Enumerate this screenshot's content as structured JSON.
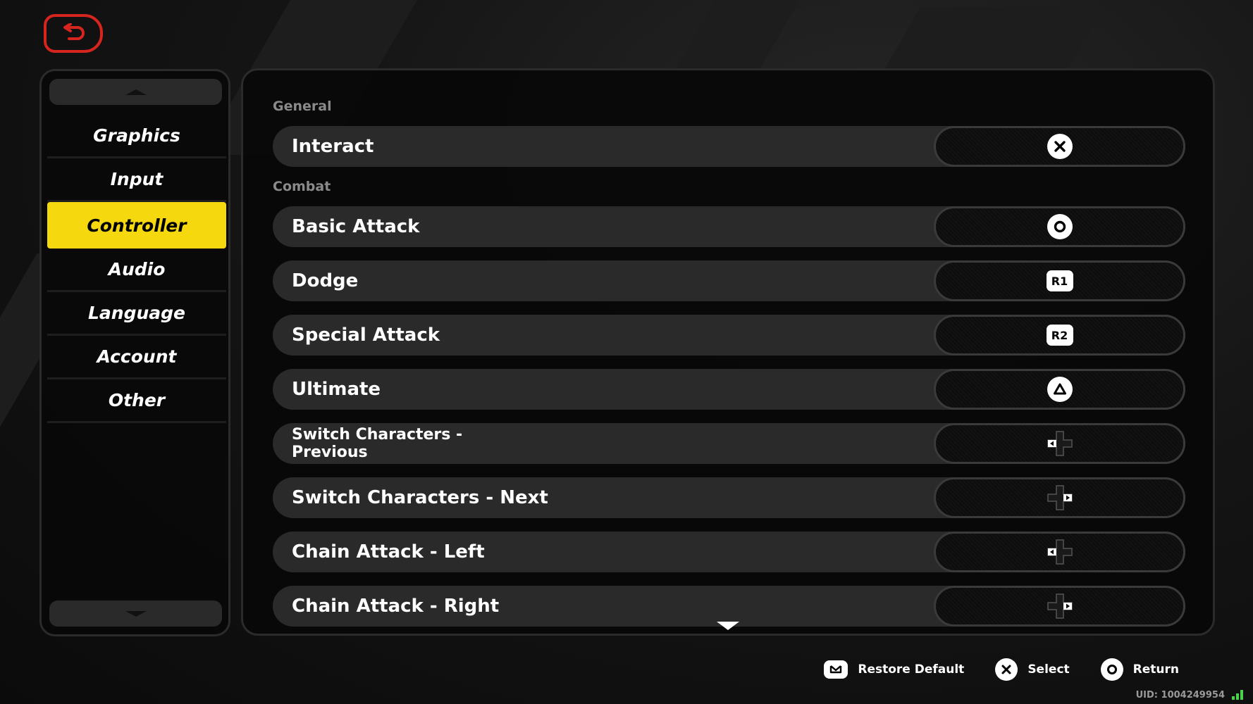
{
  "sidebar": {
    "items": [
      {
        "label": "Graphics"
      },
      {
        "label": "Input"
      },
      {
        "label": "Controller"
      },
      {
        "label": "Audio"
      },
      {
        "label": "Language"
      },
      {
        "label": "Account"
      },
      {
        "label": "Other"
      }
    ],
    "active": "Controller"
  },
  "sections": {
    "general": "General",
    "combat": "Combat"
  },
  "bindings": [
    {
      "label": "Interact",
      "key": "cross"
    },
    {
      "label": "Basic Attack",
      "key": "circle"
    },
    {
      "label": "Dodge",
      "key": "R1"
    },
    {
      "label": "Special Attack",
      "key": "R2"
    },
    {
      "label": "Ultimate",
      "key": "triangle"
    },
    {
      "label": "Switch Characters - Previous",
      "key": "dpad-left"
    },
    {
      "label": "Switch Characters - Next",
      "key": "dpad-right"
    },
    {
      "label": "Chain Attack - Left",
      "key": "dpad-left"
    },
    {
      "label": "Chain Attack - Right",
      "key": "dpad-right"
    }
  ],
  "footer": {
    "restore": "Restore Default",
    "select": "Select",
    "return": "Return"
  },
  "uid": "UID: 1004249954",
  "colors": {
    "accent": "#f6d80e",
    "back": "#d6241f"
  }
}
